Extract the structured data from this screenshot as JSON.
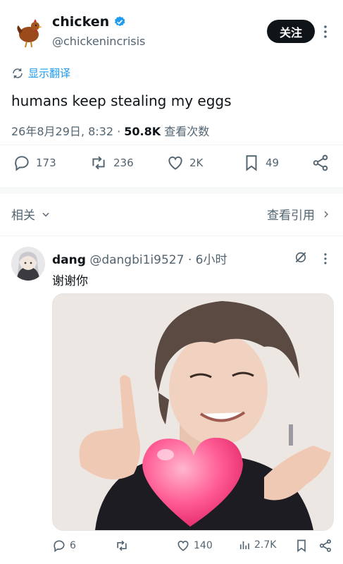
{
  "tweet": {
    "author_name": "chicken",
    "author_handle": "@chickenincrisis",
    "follow_label": "关注",
    "translate_label": "显示翻译",
    "text": "humans keep stealing my eggs",
    "timestamp": "26年8月29日, 8:32 · ",
    "views_count": "50.8K",
    "views_label": " 查看次数",
    "actions": {
      "replies": "173",
      "reposts": "236",
      "likes": "2K",
      "bookmarks": "49"
    }
  },
  "related_section": {
    "related_label": "相关",
    "view_quotes_label": "查看引用"
  },
  "reply": {
    "author_name": "dang",
    "author_handle": "@dangbi1i9527",
    "time": " · 6小时",
    "text": "谢谢你",
    "actions": {
      "replies": "6",
      "likes": "140",
      "views": "2.7K"
    }
  },
  "colors": {
    "accent": "#1d9bf0",
    "text_primary": "#0f1419",
    "text_secondary": "#536471",
    "follow_bg": "#0f1419"
  },
  "icons": [
    "verified-badge-icon",
    "more-icon",
    "translate-icon",
    "reply-icon",
    "repost-icon",
    "like-icon",
    "bookmark-icon",
    "share-icon",
    "chevron-down-icon",
    "chevron-right-icon",
    "grok-icon",
    "views-icon"
  ]
}
